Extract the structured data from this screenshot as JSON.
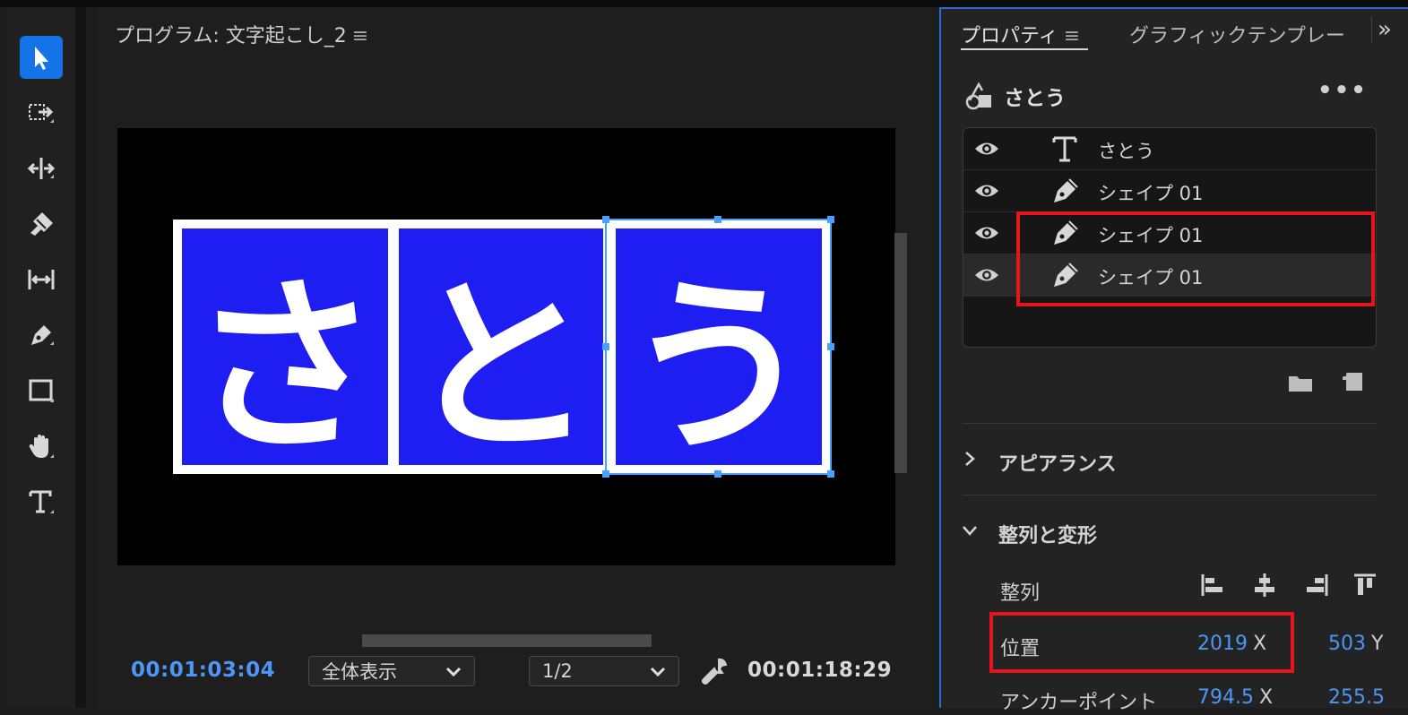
{
  "program": {
    "title": "プログラム: 文字起こし_2",
    "menu_glyph": "≡",
    "timecode_current": "00:01:03:04",
    "zoom_label": "全体表示",
    "resolution_label": "1/2",
    "timecode_duration": "00:01:18:29",
    "canvas_chars": [
      "さ",
      "と",
      "う"
    ]
  },
  "properties": {
    "tab_properties": "プロパティ",
    "tab_menu_glyph": "≡",
    "tab_graphics": "グラフィックテンプレー",
    "more_tabs_glyph": "»",
    "object_name": "さとう",
    "options_glyph": "•••",
    "layers": [
      {
        "name": "さとう",
        "type": "text-icon"
      },
      {
        "name": "シェイプ 01",
        "type": "pen-icon"
      },
      {
        "name": "シェイプ 01",
        "type": "pen-icon"
      },
      {
        "name": "シェイプ 01",
        "type": "pen-icon"
      }
    ],
    "section_appearance": "アピアランス",
    "section_align_transform": "整列と変形",
    "align_label": "整列",
    "position_label": "位置",
    "position_x": "2019",
    "position_x_axis": "X",
    "position_y": "503",
    "position_y_axis": "Y",
    "anchor_label": "アンカーポイント",
    "anchor_x": "794.5",
    "anchor_x_axis": "X",
    "anchor_y": "255.5"
  },
  "colors": {
    "accent_blue": "#4d96f5",
    "selection_blue": "#1473e6",
    "shape_blue": "#1e1ef2",
    "highlight_red": "#e8141b"
  }
}
